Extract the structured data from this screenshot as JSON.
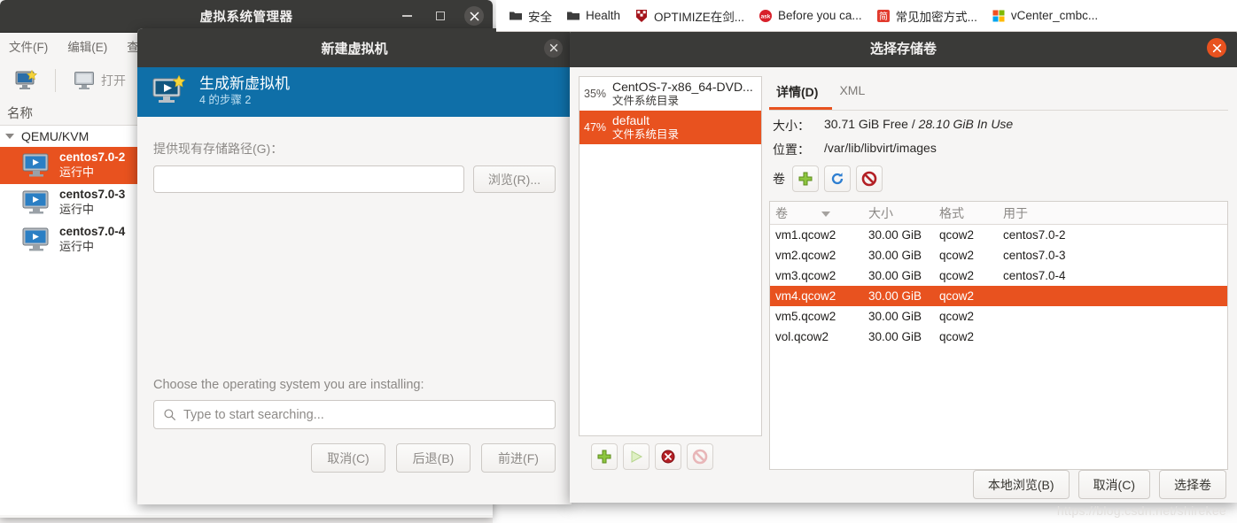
{
  "bookmarks": [
    {
      "label": "安全",
      "icon": "folder-icon"
    },
    {
      "label": "Health",
      "icon": "folder-icon"
    },
    {
      "label": "OPTIMIZE在剑...",
      "icon": "shield-crest-icon"
    },
    {
      "label": "Before you ca...",
      "icon": "ask-icon"
    },
    {
      "label": "常见加密方式...",
      "icon": "jian-icon"
    },
    {
      "label": "vCenter_cmbc...",
      "icon": "microsoft-icon"
    }
  ],
  "vmm": {
    "title": "虚拟系统管理器",
    "menus": [
      "文件(F)",
      "编辑(E)",
      "查看"
    ],
    "toolbar": {
      "new_vm_icon": "new-vm-icon",
      "open_icon": "monitor-icon",
      "open_label": "打开"
    },
    "column_header": "名称",
    "tree_root": "QEMU/KVM",
    "vms": [
      {
        "name": "centos7.0-2",
        "state": "运行中",
        "selected": true
      },
      {
        "name": "centos7.0-3",
        "state": "运行中",
        "selected": false
      },
      {
        "name": "centos7.0-4",
        "state": "运行中",
        "selected": false
      }
    ]
  },
  "wizard": {
    "title": "新建虚拟机",
    "header_title": "生成新虚拟机",
    "header_step": "4 的步骤 2",
    "storage_label": "提供现有存储路径(G)：",
    "storage_value": "",
    "browse_button": "浏览(R)...",
    "os_label": "Choose the operating system you are installing:",
    "os_search_placeholder": "Type to start searching...",
    "os_search_value": "",
    "buttons": {
      "cancel": "取消(C)",
      "back": "后退(B)",
      "forward": "前进(F)"
    }
  },
  "volume_dialog": {
    "title": "选择存储卷",
    "pools": [
      {
        "percent": "35%",
        "name": "CentOS-7-x86_64-DVD...",
        "type": "文件系统目录",
        "selected": false
      },
      {
        "percent": "47%",
        "name": "default",
        "type": "文件系统目录",
        "selected": true
      }
    ],
    "pool_tools": [
      "add-pool-icon",
      "start-pool-icon",
      "delete-pool-icon",
      "stop-pool-icon"
    ],
    "tabs": [
      {
        "label": "详情(D)",
        "active": true
      },
      {
        "label": "XML",
        "active": false
      }
    ],
    "size_label": "大小：",
    "size_free": "30.71 GiB Free /",
    "size_used": "28.10 GiB In Use",
    "location_label": "位置：",
    "location_value": "/var/lib/libvirt/images",
    "volumes_label": "卷",
    "volume_tools": [
      "add-volume-icon",
      "refresh-icon",
      "delete-volume-icon"
    ],
    "table": {
      "columns": [
        "卷",
        "大小",
        "格式",
        "用于"
      ],
      "rows": [
        {
          "volume": "vm1.qcow2",
          "size": "30.00 GiB",
          "format": "qcow2",
          "used_by": "centos7.0-2",
          "selected": false
        },
        {
          "volume": "vm2.qcow2",
          "size": "30.00 GiB",
          "format": "qcow2",
          "used_by": "centos7.0-3",
          "selected": false
        },
        {
          "volume": "vm3.qcow2",
          "size": "30.00 GiB",
          "format": "qcow2",
          "used_by": "centos7.0-4",
          "selected": false
        },
        {
          "volume": "vm4.qcow2",
          "size": "30.00 GiB",
          "format": "qcow2",
          "used_by": "",
          "selected": true
        },
        {
          "volume": "vm5.qcow2",
          "size": "30.00 GiB",
          "format": "qcow2",
          "used_by": "",
          "selected": false
        },
        {
          "volume": "vol.qcow2",
          "size": "30.00 GiB",
          "format": "qcow2",
          "used_by": "",
          "selected": false
        }
      ]
    },
    "buttons": {
      "local_browse": "本地浏览(B)",
      "cancel": "取消(C)",
      "choose": "选择卷"
    }
  },
  "watermark": "https://blog.csdn.net/shirekee",
  "colors": {
    "accent_orange": "#e8521f",
    "titlebar": "#3a3a38",
    "wizard_header": "#0f6fa8"
  }
}
